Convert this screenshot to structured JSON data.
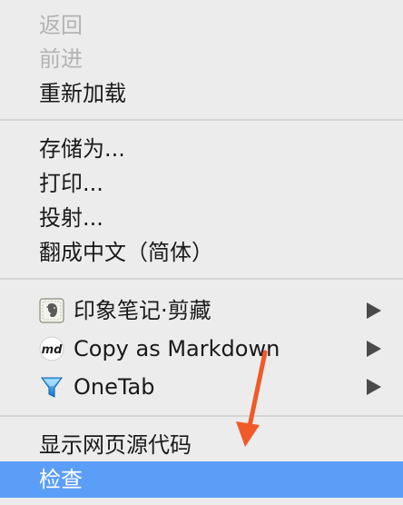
{
  "menu": {
    "back": "返回",
    "forward": "前进",
    "reload": "重新加载",
    "save_as": "存储为...",
    "print": "打印...",
    "cast": "投射...",
    "translate": "翻成中文（简体）",
    "evernote": "印象笔记·剪藏",
    "copy_markdown": "Copy as Markdown",
    "onetab": "OneTab",
    "view_source": "显示网页源代码",
    "inspect": "检查"
  },
  "icons": {
    "evernote": "evernote-elephant-icon",
    "markdown": "md-icon",
    "onetab": "onetab-funnel-icon",
    "submenu": "submenu-arrow-icon"
  },
  "colors": {
    "menu_bg": "#ececec",
    "highlight": "#5b9ef7",
    "annotation": "#f05a28"
  }
}
